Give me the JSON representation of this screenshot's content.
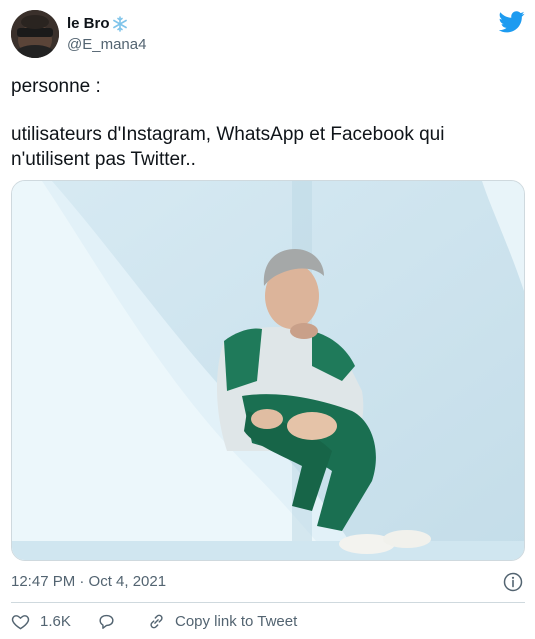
{
  "author": {
    "display_name": "le Bro",
    "name_emoji": "snowflake-icon",
    "handle": "@E_mana4"
  },
  "tweet": {
    "line1": "personne :",
    "line2": "utilisateurs d'Instagram, WhatsApp et Facebook qui",
    "line3": "n'utilisent pas Twitter.."
  },
  "meta": {
    "timestamp": "12:47 PM · Oct 4, 2021"
  },
  "actions": {
    "like_count": "1.6K",
    "copy_link_label": "Copy link to Tweet"
  },
  "colors": {
    "twitter_blue": "#1d9bf0",
    "secondary_text": "#536471",
    "border": "#cfd9de",
    "primary_text": "#0f1419"
  }
}
